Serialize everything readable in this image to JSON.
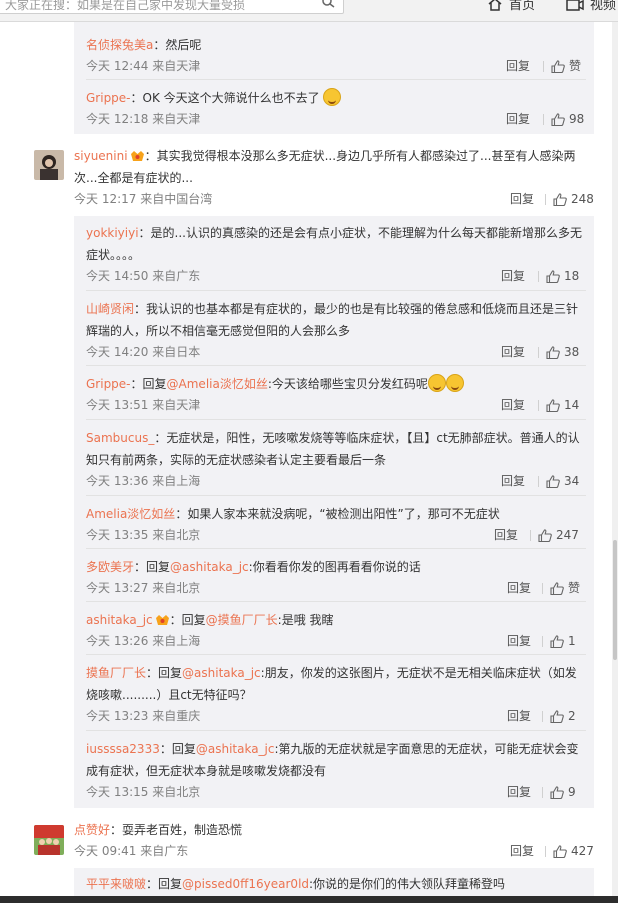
{
  "topbar": {
    "search_placeholder": "大家正在搜：如果是在自己家中发现大量受损",
    "home_label": "首页",
    "video_label": "视频"
  },
  "actions": {
    "reply": "回复",
    "like": "赞"
  },
  "thread1_replies": [
    {
      "user": "名侦探兔美a",
      "text": "：然后呢",
      "time": "今天 12:44 来自天津",
      "likes": "赞"
    },
    {
      "user": "Grippe-",
      "text": "：OK 今天这个大筛说什么也不去了",
      "time": "今天 12:18 来自天津",
      "likes": "98"
    }
  ],
  "comment2": {
    "user": "siyuenini",
    "text": "：其实我觉得根本没那么多无症状...身边几乎所有人都感染过了...甚至有人感染两次...全都是有症状的...",
    "time": "今天 12:17 来自中国台湾",
    "likes": "248"
  },
  "thread2_replies": [
    {
      "user": "yokkiyiyi",
      "text": "：是的...认识的真感染的还是会有点小症状，不能理解为什么每天都能新增那么多无症状。。。。",
      "time": "今天 14:50 来自广东",
      "likes": "18"
    },
    {
      "user": "山崎贤闲",
      "text": "：我认识的也基本都是有症状的，最少的也是有比较强的倦怠感和低烧而且还是三针辉瑞的人，所以不相信毫无感觉但阳的人会那么多",
      "time": "今天 14:20 来自日本",
      "likes": "38"
    },
    {
      "user": "Grippe-",
      "pre": "：回复",
      "mention": "@Amelia淡忆如丝",
      "post": ":今天该给哪些宝贝分发红码呢",
      "time": "今天 13:51 来自天津",
      "likes": "14"
    },
    {
      "user": "Sambucus_",
      "text": "：无症状是，阳性，无咳嗽发烧等等临床症状，【且】ct无肺部症状。普通人的认知只有前两条，实际的无症状感染者认定主要看最后一条",
      "time": "今天 13:36 来自上海",
      "likes": "34"
    },
    {
      "user": "Amelia淡忆如丝",
      "text": "：如果人家本来就没病呢，“被检测出阳性”了，那可不无症状",
      "time": "今天 13:35 来自北京",
      "likes": "247"
    },
    {
      "user": "多欧美牙",
      "pre": "：回复",
      "mention": "@ashitaka_jc",
      "post": ":你看看你发的图再看看你说的话",
      "time": "今天 13:27 来自北京",
      "likes": "赞"
    },
    {
      "user": "ashitaka_jc",
      "pre": "：回复",
      "mention": "@摸鱼厂厂长",
      "post": ":是哦 我瞎",
      "time": "今天 13:26 来自上海",
      "likes": "1"
    },
    {
      "user": "摸鱼厂厂长",
      "pre": "：回复",
      "mention": "@ashitaka_jc",
      "post": ":朋友，你发的这张图片，无症状不是无相关临床症状（如发烧咳嗽.........）且ct无特征吗？",
      "time": "今天 13:23 来自重庆",
      "likes": "2"
    },
    {
      "user": "iussssa2333",
      "pre": "：回复",
      "mention": "@ashitaka_jc",
      "post": ":第九版的无症状就是字面意思的无症状，可能无症状会变成有症状，但无症状本身就是咳嗽发烧都没有",
      "time": "今天 13:15 来自北京",
      "likes": "9"
    }
  ],
  "comment3": {
    "user": "点赞好",
    "text": "：耍弄老百姓，制造恐慌",
    "time": "今天 09:41 来自广东",
    "likes": "427"
  },
  "thread3_replies": [
    {
      "user": "平平来啵啵",
      "pre": "：回复",
      "mention": "@pissed0ff16year0ld",
      "post": ":你说的是你们的伟大领队拜童稀登吗"
    }
  ]
}
